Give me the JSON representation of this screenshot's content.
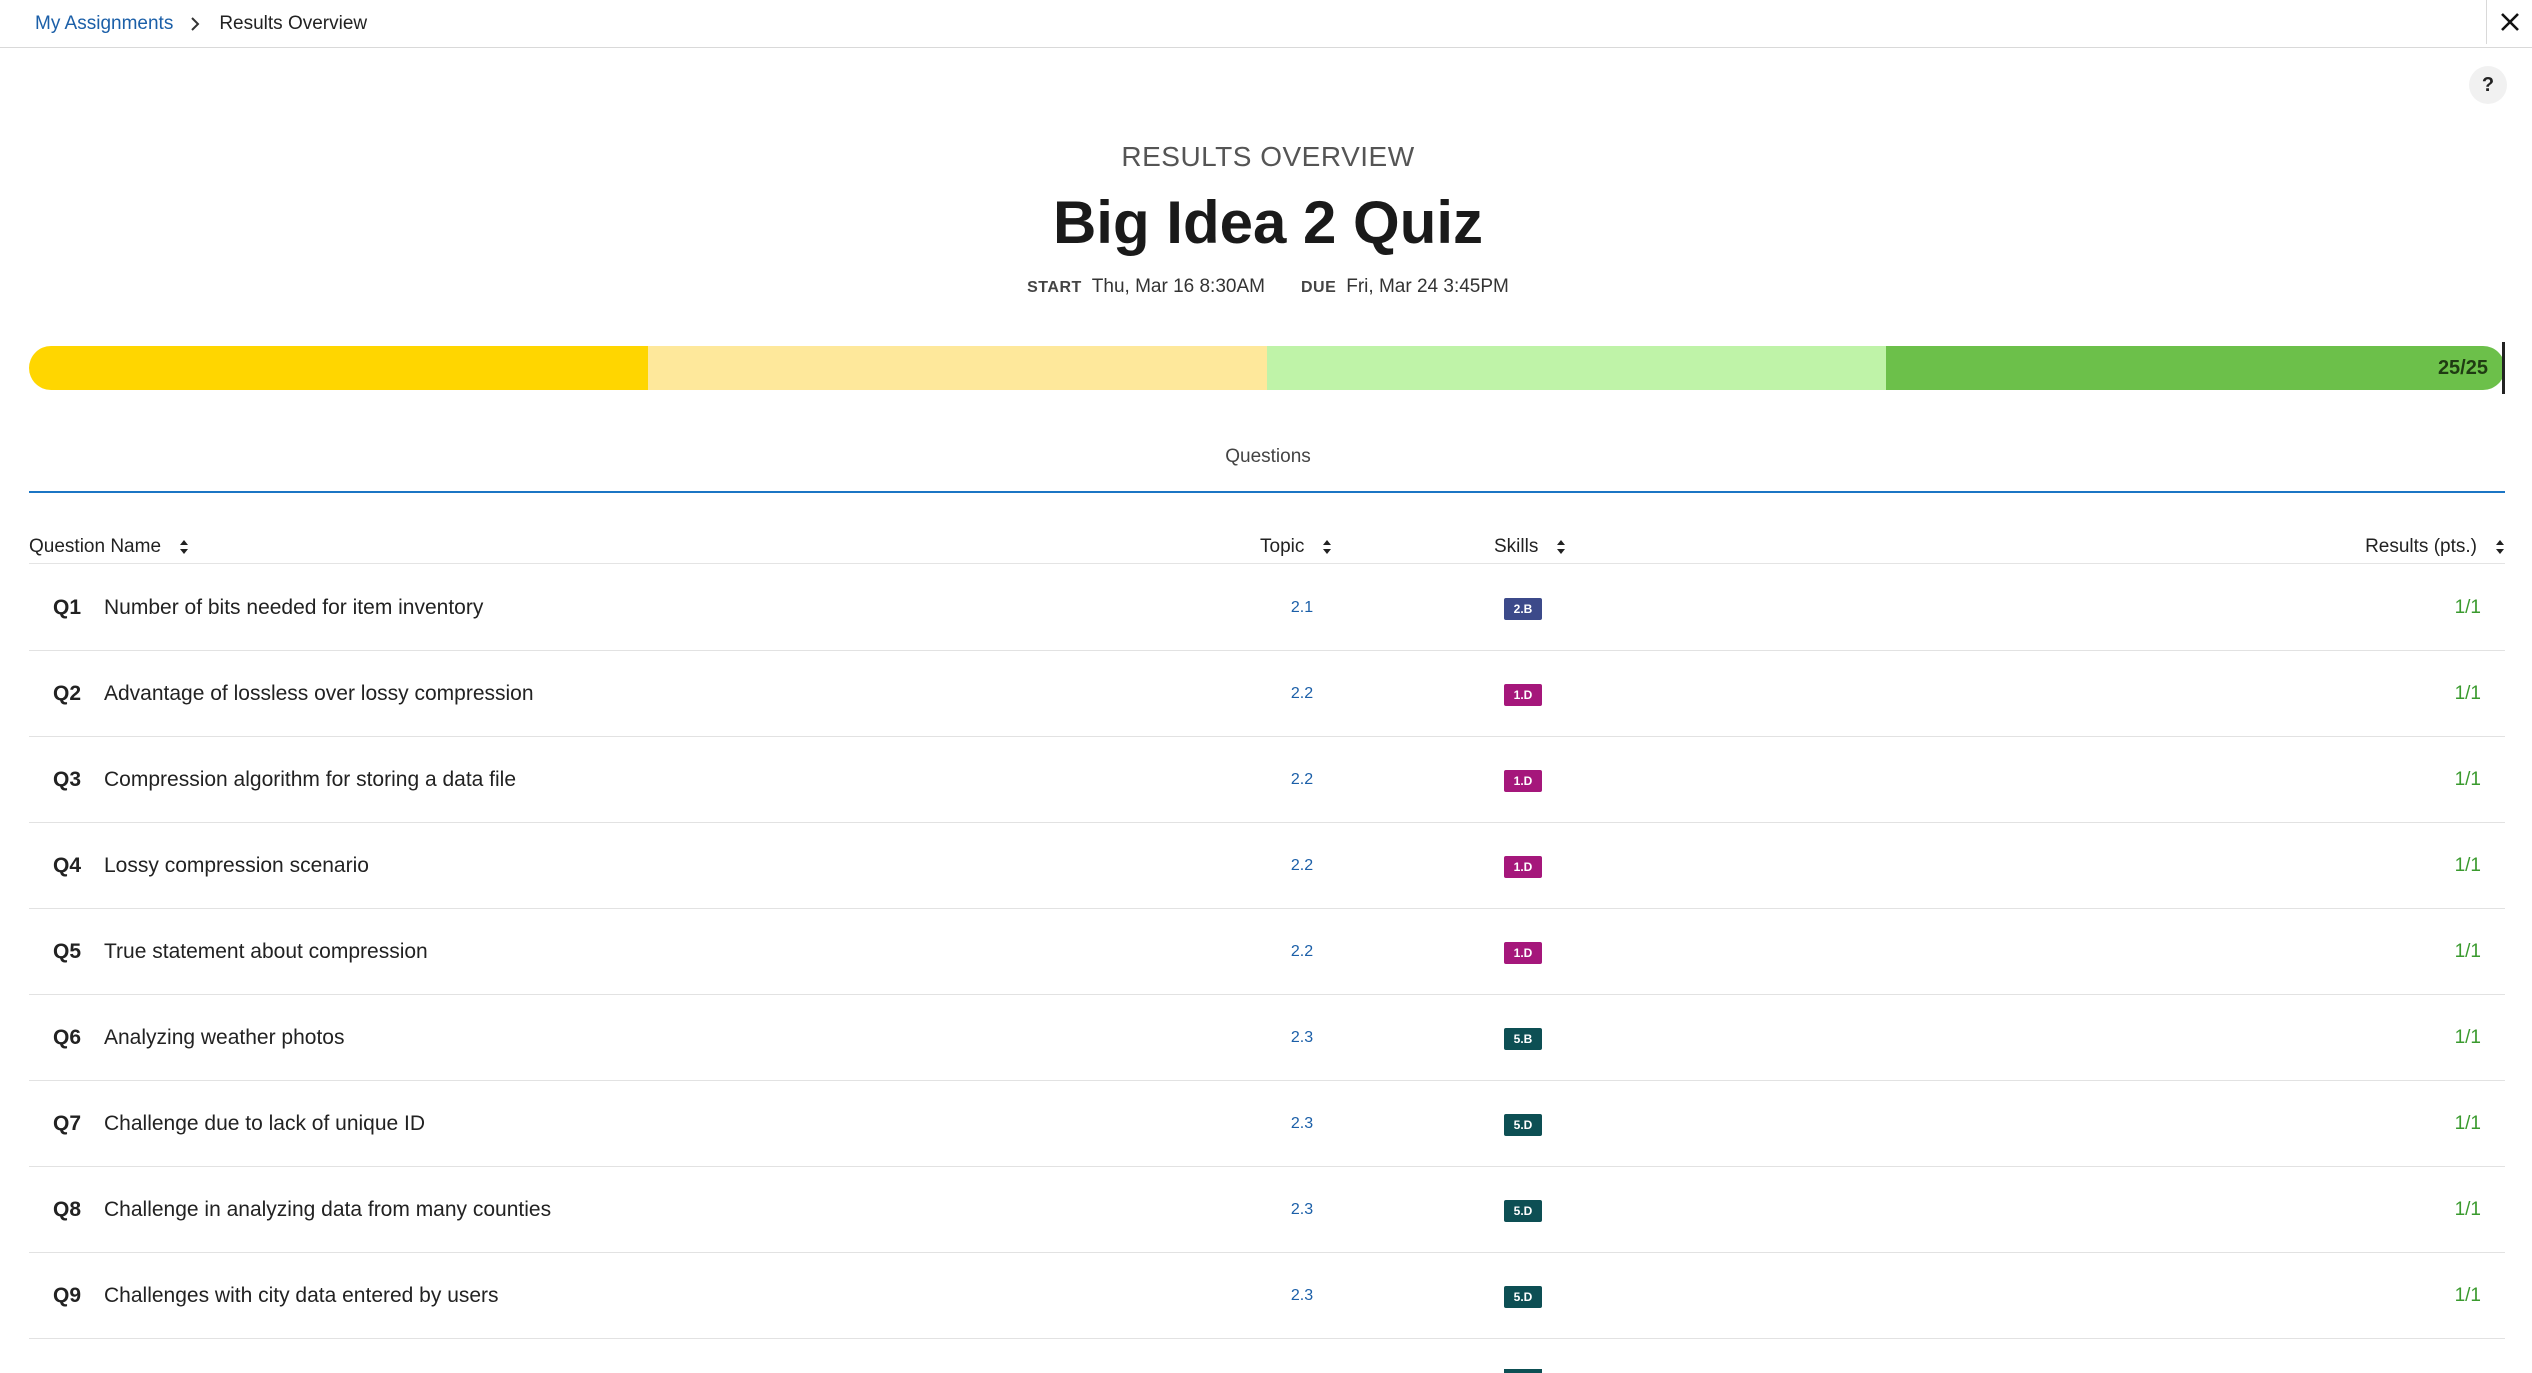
{
  "breadcrumb": {
    "parent": "My Assignments",
    "current": "Results Overview"
  },
  "header": {
    "eyebrow": "RESULTS OVERVIEW",
    "title": "Big Idea 2 Quiz",
    "start_label": "START",
    "start_value": "Thu, Mar 16 8:30AM",
    "due_label": "DUE",
    "due_value": "Fri, Mar 24 3:45PM"
  },
  "progress": {
    "score": "25/25",
    "fraction": 1.0,
    "segments": [
      "#ffd600",
      "#fee89b",
      "#bff3a8",
      "#6cc04a"
    ]
  },
  "tabs": {
    "questions": "Questions"
  },
  "table": {
    "headers": {
      "name": "Question Name",
      "topic": "Topic",
      "skills": "Skills",
      "results": "Results (pts.)"
    },
    "rows": [
      {
        "num": "Q1",
        "name": "Number of bits needed for item inventory",
        "topic": "2.1",
        "skill": "2.B",
        "skill_color": "#3c4a8a",
        "result": "1/1"
      },
      {
        "num": "Q2",
        "name": "Advantage of lossless over lossy compression",
        "topic": "2.2",
        "skill": "1.D",
        "skill_color": "#a5177b",
        "result": "1/1"
      },
      {
        "num": "Q3",
        "name": "Compression algorithm for storing a data file",
        "topic": "2.2",
        "skill": "1.D",
        "skill_color": "#a5177b",
        "result": "1/1"
      },
      {
        "num": "Q4",
        "name": "Lossy compression scenario",
        "topic": "2.2",
        "skill": "1.D",
        "skill_color": "#a5177b",
        "result": "1/1"
      },
      {
        "num": "Q5",
        "name": "True statement about compression",
        "topic": "2.2",
        "skill": "1.D",
        "skill_color": "#a5177b",
        "result": "1/1"
      },
      {
        "num": "Q6",
        "name": "Analyzing weather photos",
        "topic": "2.3",
        "skill": "5.B",
        "skill_color": "#0d4f54",
        "result": "1/1"
      },
      {
        "num": "Q7",
        "name": "Challenge due to lack of unique ID",
        "topic": "2.3",
        "skill": "5.D",
        "skill_color": "#0d4f54",
        "result": "1/1"
      },
      {
        "num": "Q8",
        "name": "Challenge in analyzing data from many counties",
        "topic": "2.3",
        "skill": "5.D",
        "skill_color": "#0d4f54",
        "result": "1/1"
      },
      {
        "num": "Q9",
        "name": "Challenges with city data entered by users",
        "topic": "2.3",
        "skill": "5.D",
        "skill_color": "#0d4f54",
        "result": "1/1"
      }
    ]
  }
}
